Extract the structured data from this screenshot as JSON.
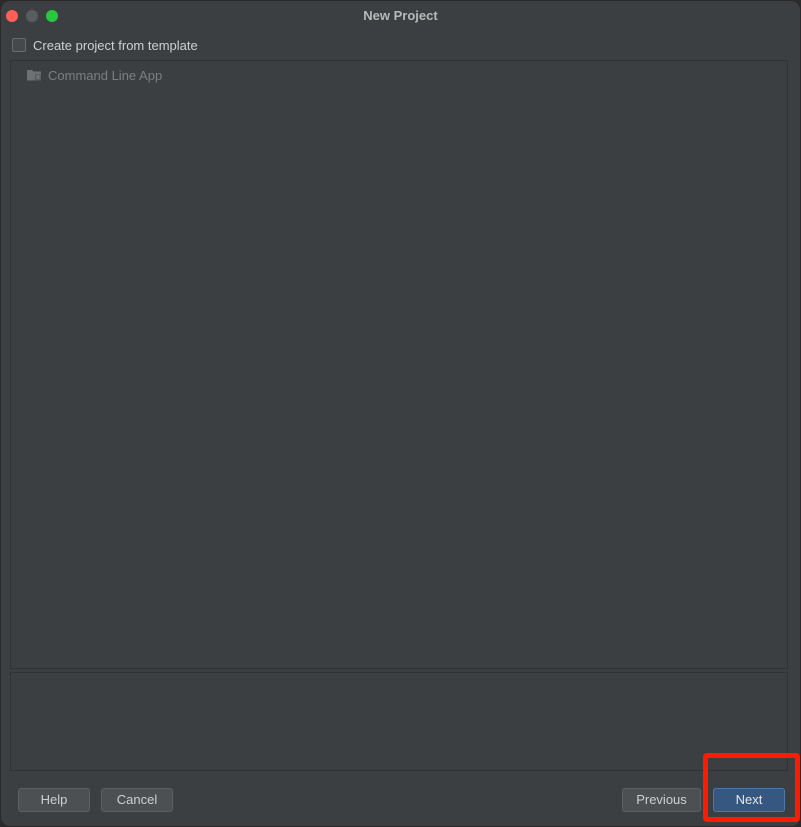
{
  "window": {
    "title": "New Project"
  },
  "template_option": {
    "label": "Create project from template",
    "checked": false
  },
  "template_list": {
    "items": [
      {
        "label": "Command Line App",
        "icon": "folder-icon"
      }
    ]
  },
  "buttons": {
    "help": "Help",
    "cancel": "Cancel",
    "previous": "Previous",
    "next": "Next"
  },
  "colors": {
    "background": "#3c3f41",
    "primary_button": "#365880",
    "highlight": "#ff1a00"
  }
}
